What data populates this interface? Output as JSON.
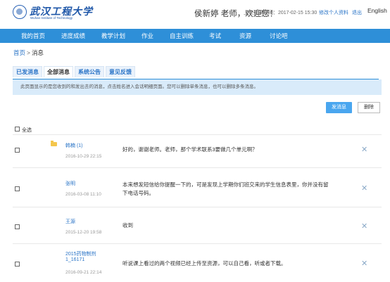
{
  "header": {
    "logo_cn": "武汉工程大学",
    "logo_en": "Wuhan Institute of Technology",
    "greeting": "侯新婷 老师，欢迎您！",
    "last_login": "上次登录时间：2017-02-15 15:30",
    "profile_link": "修改个人资料",
    "logout_link": "退出",
    "language": "English"
  },
  "nav": [
    "我的首页",
    "进度成绩",
    "教学计划",
    "作业",
    "自主训练",
    "考试",
    "资源",
    "讨论吧"
  ],
  "breadcrumb": {
    "home": "首页",
    "separator": ">",
    "current": "消息"
  },
  "tabs": [
    {
      "label": "已发消息",
      "active": false
    },
    {
      "label": "全部消息",
      "active": true
    },
    {
      "label": "系统公告",
      "active": false
    },
    {
      "label": "意见反馈",
      "active": false
    }
  ],
  "notice": "此页面显示的是您收到的和发出去的消息，点击姓名进入会话明细页面。您可以删除单条消息，也可以删除多条消息。",
  "buttons": {
    "send": "发消息",
    "delete": "删除"
  },
  "select_all": "全选",
  "messages": [
    {
      "sender": "韩楠 (1)",
      "date": "2016-10-29 22:15",
      "text": "好的，谢谢老师。老师，那个学术联系3要做几个单元啊？",
      "icon": "folder-icon"
    },
    {
      "sender": "张明",
      "date": "2016-03-08 11:10",
      "text": "本来想发短信给你提醒一下的，可是发现上学期你们班交来的学生信息表里，你并没有留下电话号码。"
    },
    {
      "sender": "王源",
      "date": "2015-12-20 19:58",
      "text": "收到"
    },
    {
      "sender": "2015药物制剂1_16171",
      "sender_line1": "2015药物制剂",
      "sender_line2": "1_16171",
      "date": "2016-09-21 22:14",
      "text": "听说课上看过的两个视频已经上传至资源，可以自己看，听或者下载。"
    }
  ],
  "colors": {
    "nav_bg": "#2e8fd8",
    "link": "#2a74c7",
    "notice_bg": "#d9ebfa",
    "send_btn": "#49a6ef"
  }
}
